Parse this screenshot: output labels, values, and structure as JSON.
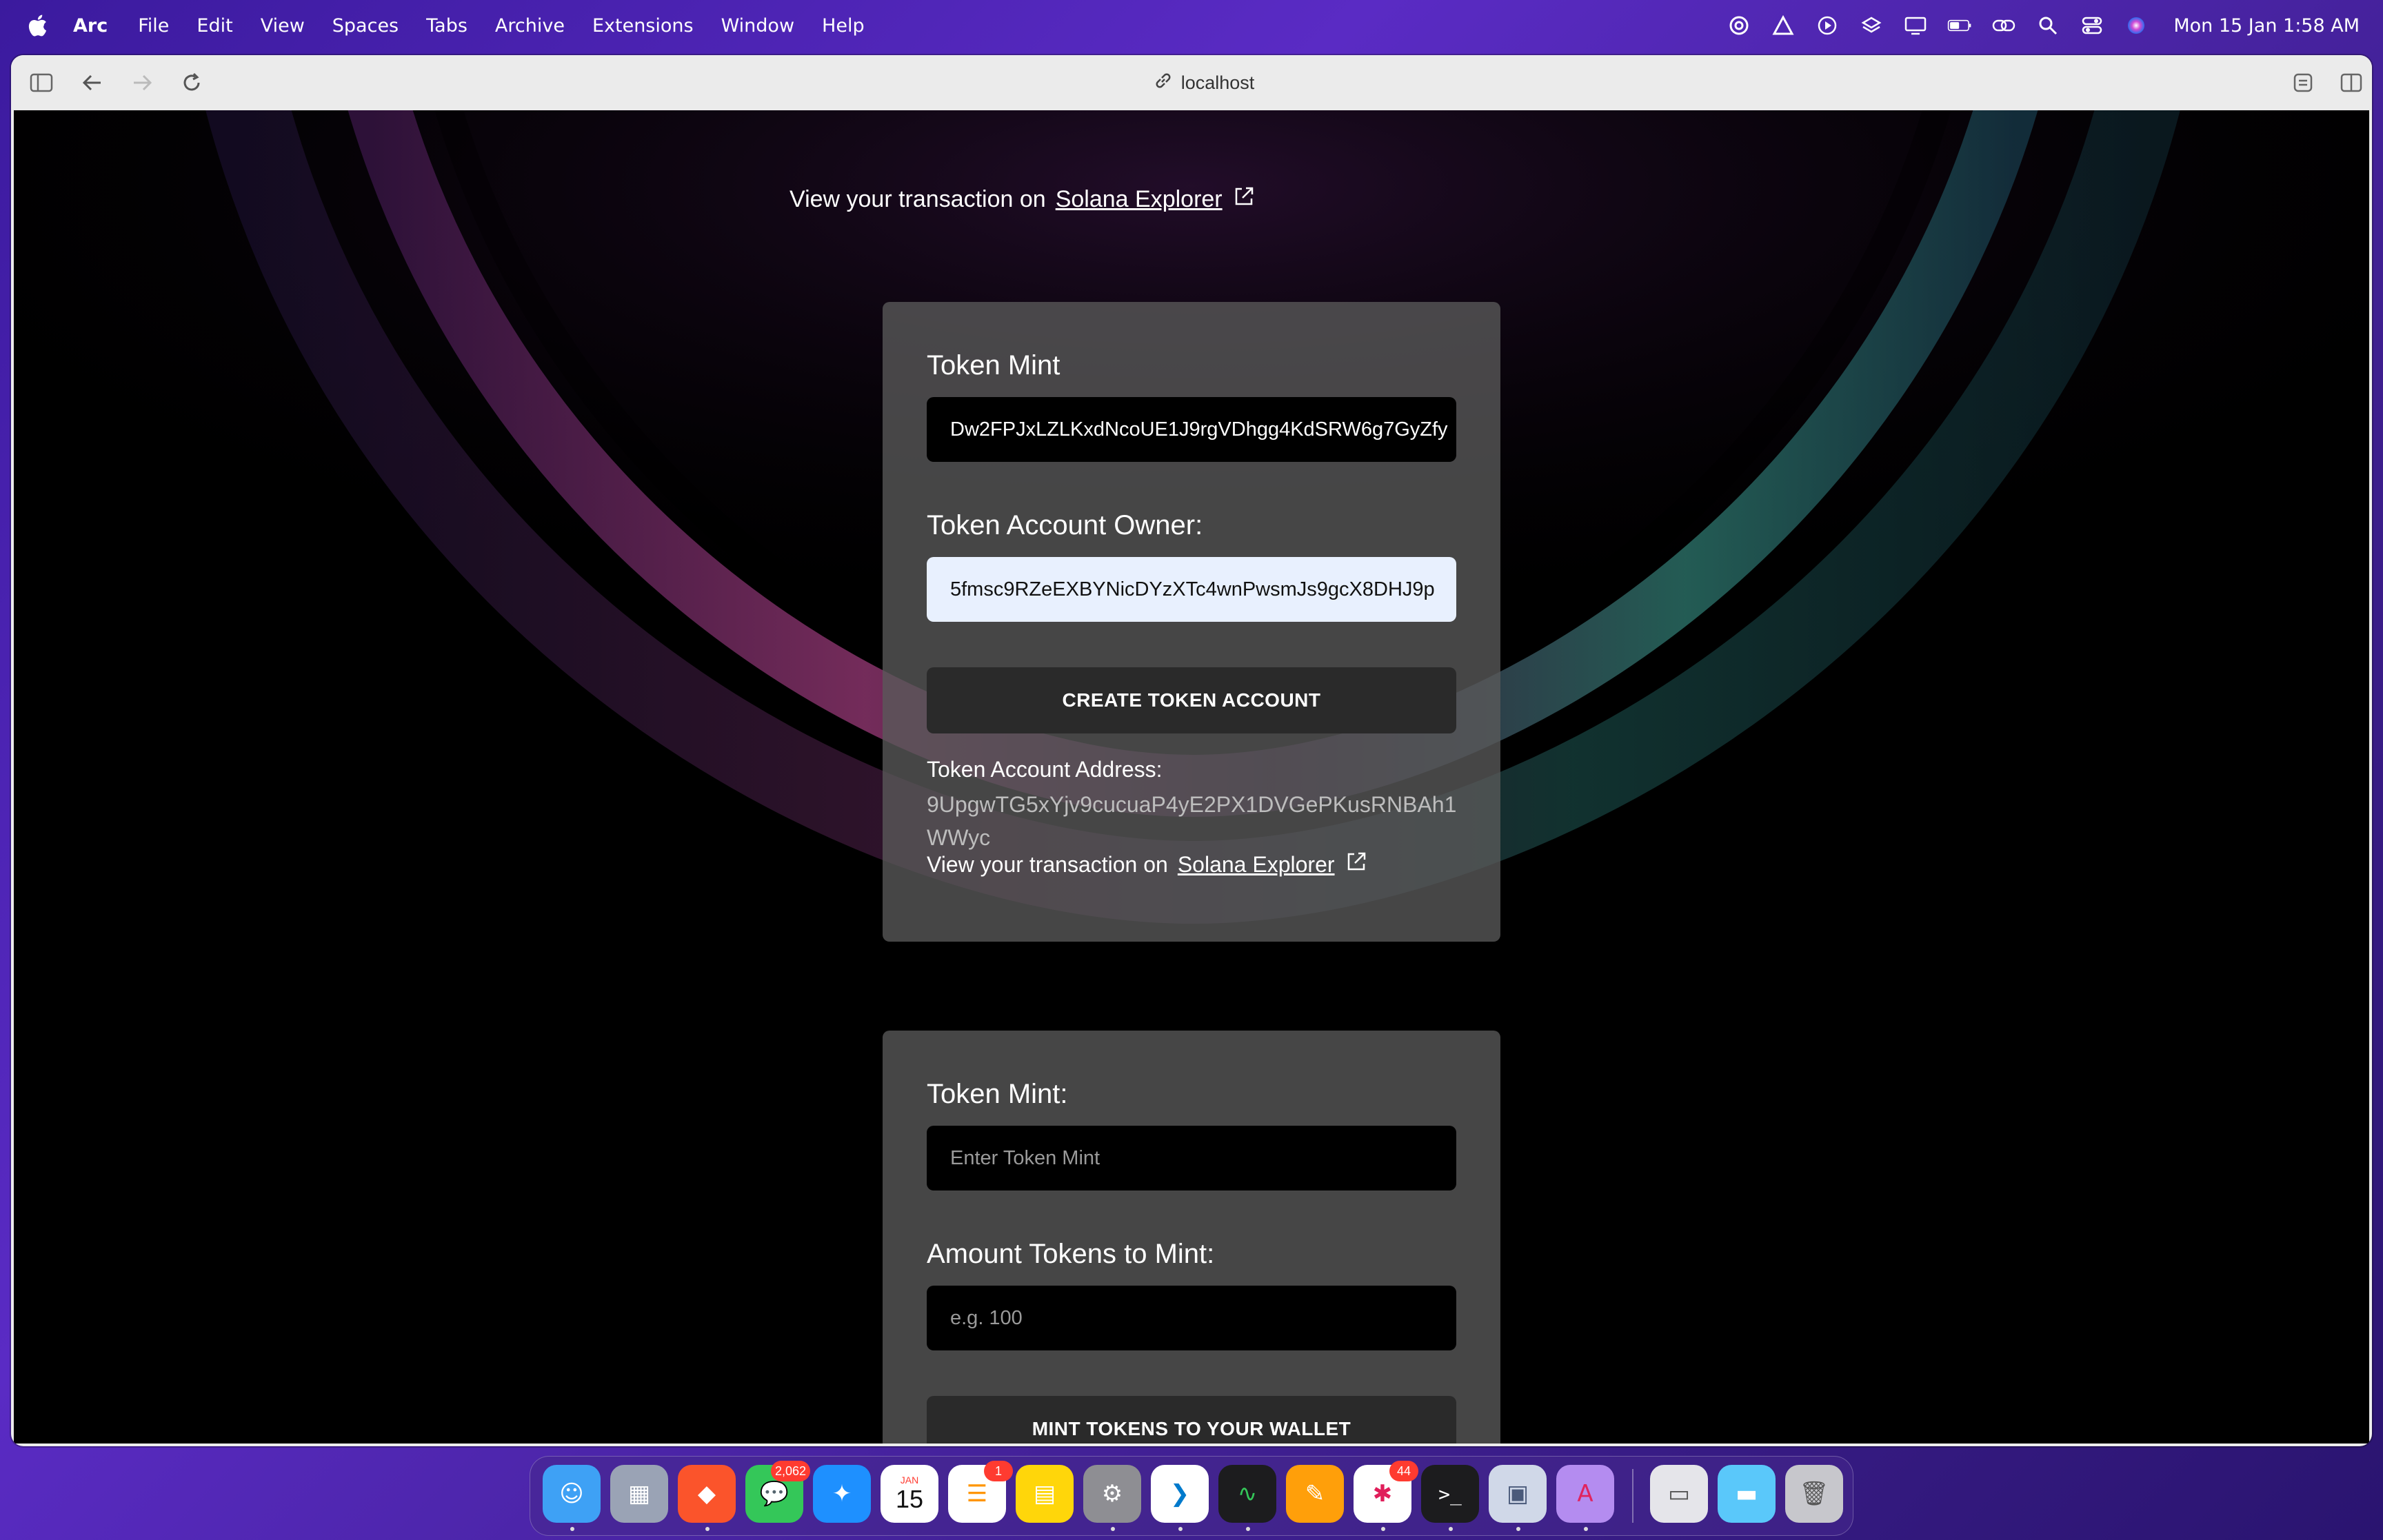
{
  "menubar": {
    "app_name": "Arc",
    "items": [
      "File",
      "Edit",
      "View",
      "Spaces",
      "Tabs",
      "Archive",
      "Extensions",
      "Window",
      "Help"
    ],
    "clock": "Mon 15 Jan  1:58 AM"
  },
  "browser": {
    "url": "localhost"
  },
  "page": {
    "top_transaction": {
      "prefix": "View your transaction on",
      "link": "Solana Explorer"
    },
    "create_account_card": {
      "token_mint_label": "Token Mint",
      "token_mint_value": "Dw2FPJxLZLKxdNcoUE1J9rgVDhgg4KdSRW6g7GyZfy",
      "owner_label": "Token Account Owner:",
      "owner_value": "5fmsc9RZeEXBYNicDYzXTc4wnPwsmJs9gcX8DHJ9p",
      "button_label": "CREATE TOKEN ACCOUNT",
      "address_label": "Token Account Address:",
      "address_value": "9UpgwTG5xYjv9cucuaP4yE2PX1DVGePKusRNBAh1WWyc",
      "tx_prefix": "View your transaction on",
      "tx_link": "Solana Explorer"
    },
    "mint_card": {
      "token_mint_label": "Token Mint:",
      "token_mint_placeholder": "Enter Token Mint",
      "amount_label": "Amount Tokens to Mint:",
      "amount_placeholder": "e.g. 100",
      "button_label": "MINT TOKENS TO YOUR WALLET"
    }
  },
  "dock": {
    "apps": [
      {
        "name": "Finder",
        "icon": "finder-icon",
        "color": "#3ea1f5"
      },
      {
        "name": "Launchpad",
        "icon": "launchpad-icon",
        "color": "#9aa3b5"
      },
      {
        "name": "Brave",
        "icon": "brave-icon",
        "color": "#fb542b"
      },
      {
        "name": "Messages",
        "icon": "messages-icon",
        "color": "#34c759",
        "badge": "2,062"
      },
      {
        "name": "Safari",
        "icon": "safari-icon",
        "color": "#1e90ff"
      },
      {
        "name": "Calendar",
        "icon": "calendar-icon",
        "color": "#ffffff",
        "month": "JAN",
        "day": "15"
      },
      {
        "name": "Reminders",
        "icon": "reminders-icon",
        "color": "#ffffff",
        "badge": "1"
      },
      {
        "name": "Notes",
        "icon": "notes-icon",
        "color": "#ffd60a"
      },
      {
        "name": "System Settings",
        "icon": "settings-icon",
        "color": "#8e8e93"
      },
      {
        "name": "VS Code",
        "icon": "vscode-icon",
        "color": "#ffffff"
      },
      {
        "name": "Activity Monitor",
        "icon": "activity-monitor-icon",
        "color": "#1c1c1e"
      },
      {
        "name": "Pages",
        "icon": "pages-icon",
        "color": "#ff9f0a"
      },
      {
        "name": "Slack",
        "icon": "slack-icon",
        "color": "#ffffff",
        "badge": "44"
      },
      {
        "name": "Terminal",
        "icon": "terminal-icon",
        "color": "#1c1c1e"
      },
      {
        "name": "Preview",
        "icon": "preview-icon",
        "color": "#d0d8e8"
      },
      {
        "name": "Arc",
        "icon": "arc-icon",
        "color": "#b48cf0"
      },
      {
        "name": "Recents",
        "icon": "recents-stack-icon",
        "color": "#e5e5ea"
      },
      {
        "name": "Folder",
        "icon": "folder-icon",
        "color": "#5ac8fa"
      },
      {
        "name": "Trash",
        "icon": "trash-icon",
        "color": "#c7c7cc"
      }
    ]
  }
}
